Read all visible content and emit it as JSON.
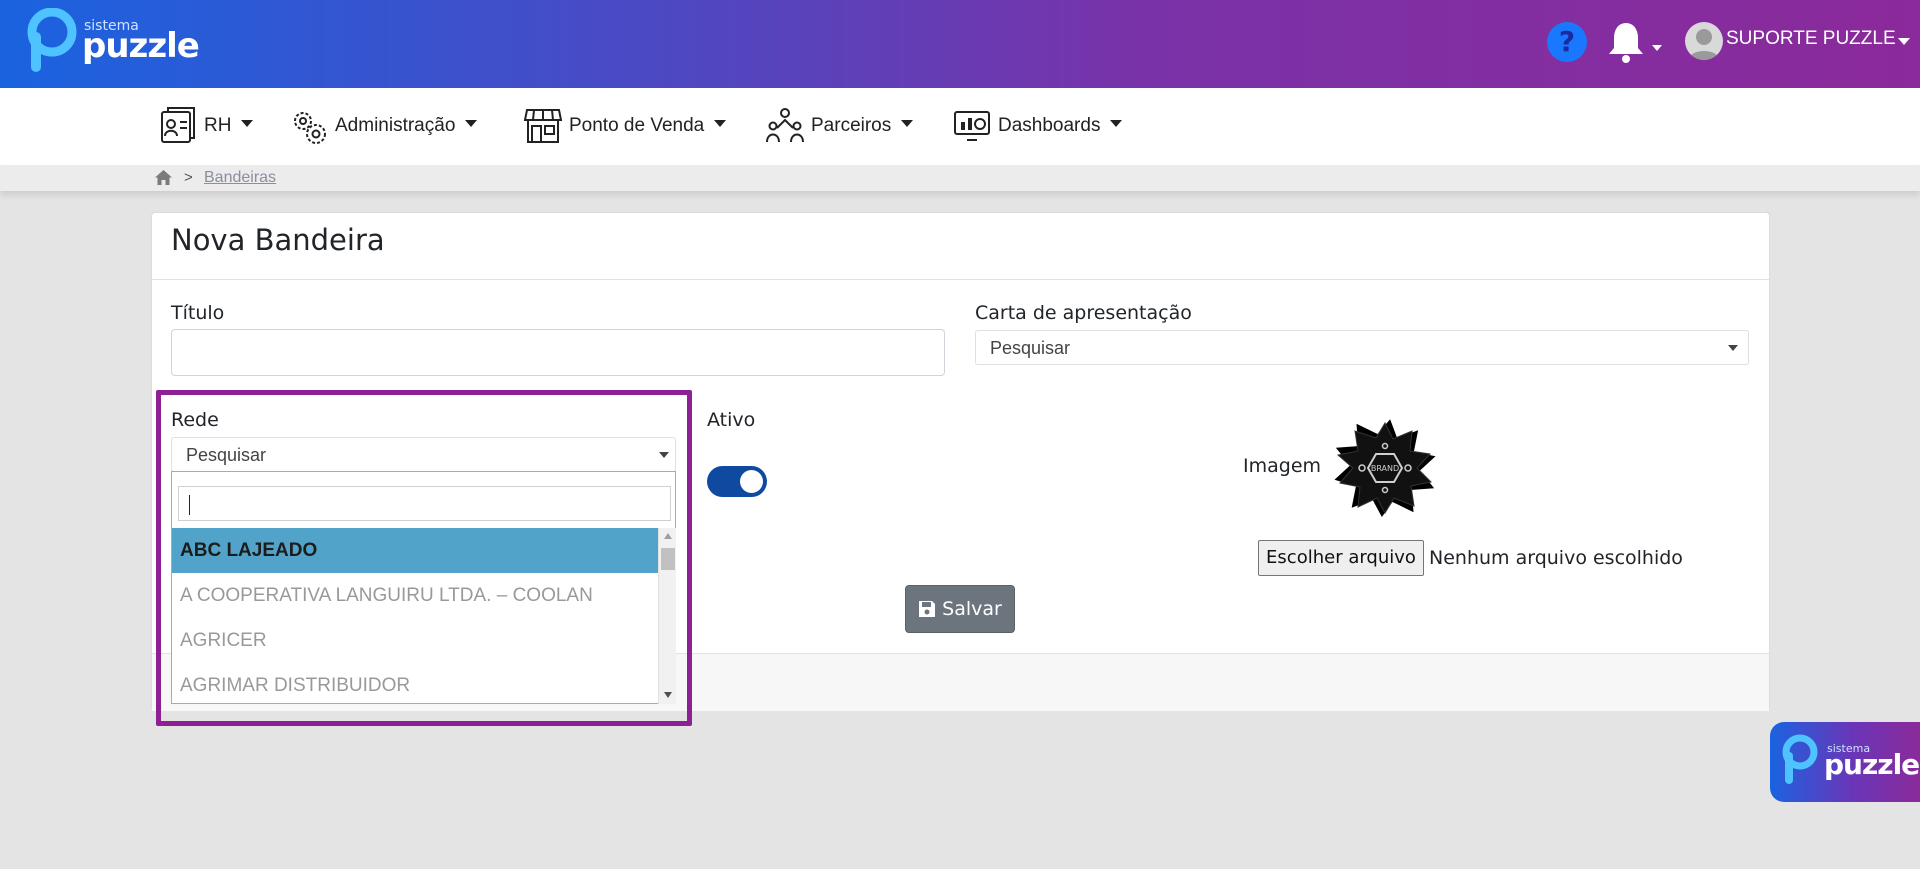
{
  "header": {
    "logo_small": "sistema",
    "logo_big": "puzzle",
    "help_glyph": "?",
    "user_name": "SUPORTE PUZZLE",
    "icons": [
      "help-icon",
      "bell-icon",
      "avatar-icon",
      "chevron-down-icon"
    ]
  },
  "menu": {
    "items": [
      {
        "label": "RH",
        "icon": "id-card-icon"
      },
      {
        "label": "Administração",
        "icon": "gears-icon"
      },
      {
        "label": "Ponto de Venda",
        "icon": "store-icon"
      },
      {
        "label": "Parceiros",
        "icon": "people-icon"
      },
      {
        "label": "Dashboards",
        "icon": "monitor-chart-icon"
      }
    ]
  },
  "breadcrumb": {
    "separator": ">",
    "current": "Bandeiras"
  },
  "form": {
    "title": "Nova Bandeira",
    "titulo_label": "Título",
    "titulo_value": "",
    "carta_label": "Carta de apresentação",
    "carta_value": "Pesquisar",
    "rede_label": "Rede",
    "rede_value": "Pesquisar",
    "ativo_label": "Ativo",
    "ativo_on": true,
    "imagem_label": "Imagem",
    "file_button": "Escolher arquivo",
    "file_status": "Nenhum arquivo escolhido",
    "save_label": "Salvar",
    "image_text": "BRAND"
  },
  "dropdown": {
    "search_value": "",
    "options": [
      {
        "label": "ABC LAJEADO",
        "selected": true
      },
      {
        "label": "A COOPERATIVA LANGUIRU LTDA. – COOLAN",
        "selected": false
      },
      {
        "label": "AGRICER",
        "selected": false
      },
      {
        "label": "AGRIMAR DISTRIBUIDOR",
        "selected": false
      }
    ]
  },
  "badge": {
    "small": "sistema",
    "big": "puzzle"
  },
  "colors": {
    "header_start": "#1a63e0",
    "header_end": "#8b2a9a",
    "highlight": "#8e1f94",
    "selected_option": "#52a3c9",
    "toggle": "#0f4aa0",
    "save_button": "#6c757d"
  }
}
